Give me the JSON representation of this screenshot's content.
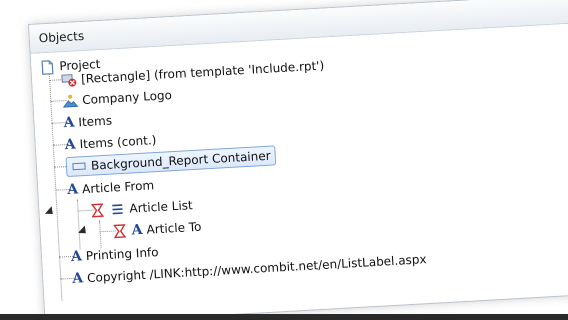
{
  "panel": {
    "title": "Objects"
  },
  "tree": {
    "root": {
      "label": "Project",
      "icon": "document-icon"
    },
    "items": [
      {
        "label": "[Rectangle] (from template 'Include.rpt')",
        "icon": "rectangle-template-icon"
      },
      {
        "label": "Company Logo",
        "icon": "picture-icon"
      },
      {
        "label": "Items",
        "icon": "text-icon"
      },
      {
        "label": "Items (cont.)",
        "icon": "text-icon"
      },
      {
        "label": "Background_Report Container",
        "icon": "container-icon",
        "selected": true
      },
      {
        "label": "Article From",
        "icon": "text-icon"
      },
      {
        "label": "Article List",
        "icon": "table-icon",
        "prefix": "filter-icon"
      },
      {
        "label": "Article To",
        "icon": "text-icon",
        "prefix": "filter-icon"
      },
      {
        "label": "Printing Info",
        "icon": "text-icon"
      },
      {
        "label": "Copyright /LINK:http://www.combit.net/en/ListLabel.aspx",
        "icon": "text-icon"
      }
    ]
  },
  "colors": {
    "accent": "#23479a",
    "selection_border": "#7fa6d8",
    "filter_red": "#d03030"
  }
}
